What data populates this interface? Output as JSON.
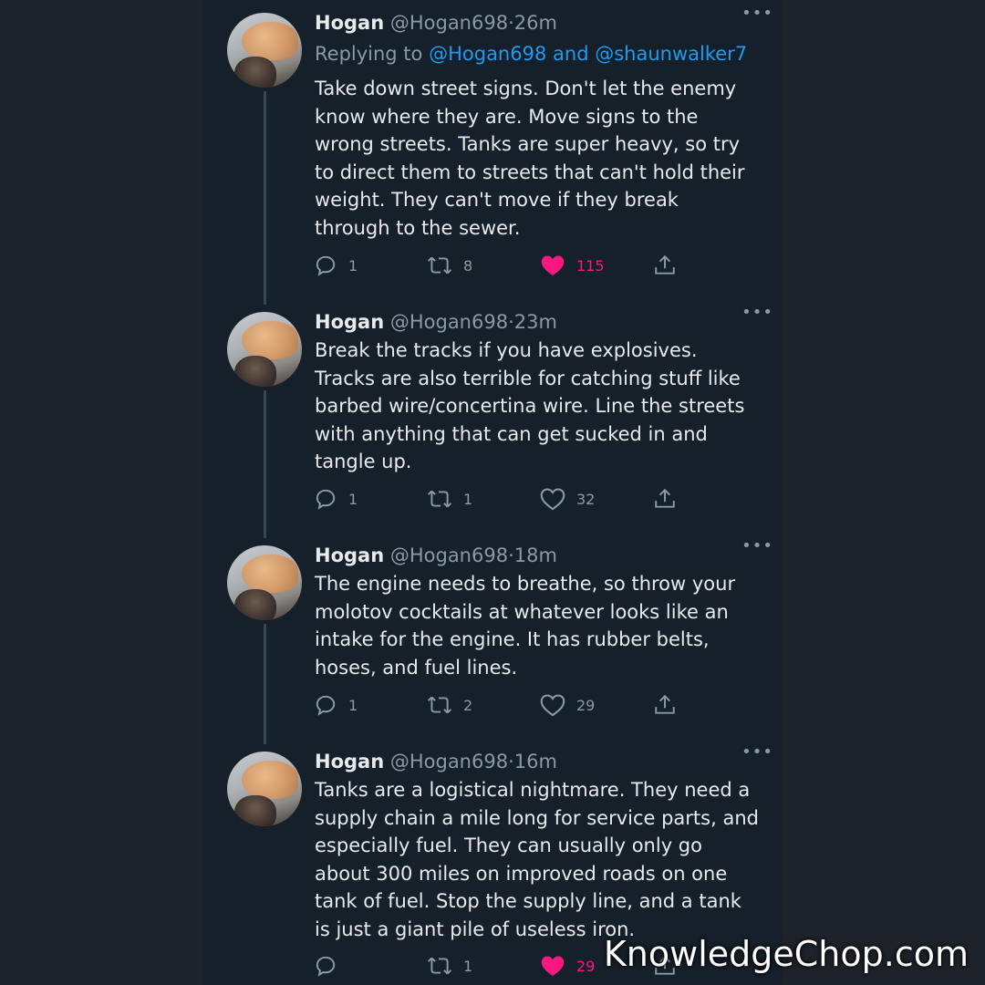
{
  "watermark": "KnowledgeChop.com",
  "tweets": [
    {
      "name": "Hogan",
      "handle": "@Hogan698",
      "sep": "·",
      "time": "26m",
      "reply_prefix": "Replying to",
      "reply_mention_1": "@Hogan698",
      "reply_and": "and",
      "reply_mention_2": "@shaunwalker7",
      "text": "Take down street signs. Don't let the enemy\nknow where they are. Move signs to the\nwrong streets. Tanks are super heavy, so try\nto direct them to streets that can't hold their\nweight. They can't move if they break\nthrough to the sewer.",
      "replies": "1",
      "retweets": "8",
      "likes": "115",
      "liked": true
    },
    {
      "name": "Hogan",
      "handle": "@Hogan698",
      "sep": "·",
      "time": "23m",
      "text": "Break the tracks if you have explosives.\nTracks are also terrible for catching stuff like\nbarbed wire/concertina wire. Line the streets\nwith anything that can get sucked in and\ntangle up.",
      "replies": "1",
      "retweets": "1",
      "likes": "32",
      "liked": false
    },
    {
      "name": "Hogan",
      "handle": "@Hogan698",
      "sep": "·",
      "time": "18m",
      "text": "The engine needs to breathe, so throw your\nmolotov cocktails at whatever looks like an\nintake for the engine. It has rubber belts,\nhoses, and fuel lines.",
      "replies": "1",
      "retweets": "2",
      "likes": "29",
      "liked": false
    },
    {
      "name": "Hogan",
      "handle": "@Hogan698",
      "sep": "·",
      "time": "16m",
      "text": "Tanks are a logistical nightmare. They need a\nsupply chain a mile long for service parts, and\nespecially fuel. They can usually only go\nabout 300 miles on improved roads on one\ntank of fuel. Stop the supply line, and a tank\nis just a giant pile of useless iron.",
      "replies": "",
      "retweets": "1",
      "likes": "29",
      "liked": true
    }
  ],
  "icons": {
    "reply": "reply-icon",
    "retweet": "retweet-icon",
    "like": "heart-icon",
    "share": "share-icon",
    "more": "more-icon"
  },
  "colors": {
    "background": "#15202b",
    "outer": "#1e232b",
    "text": "#e8eaec",
    "muted": "#8b98a5",
    "link": "#1d9bf0",
    "like": "#f91880"
  }
}
